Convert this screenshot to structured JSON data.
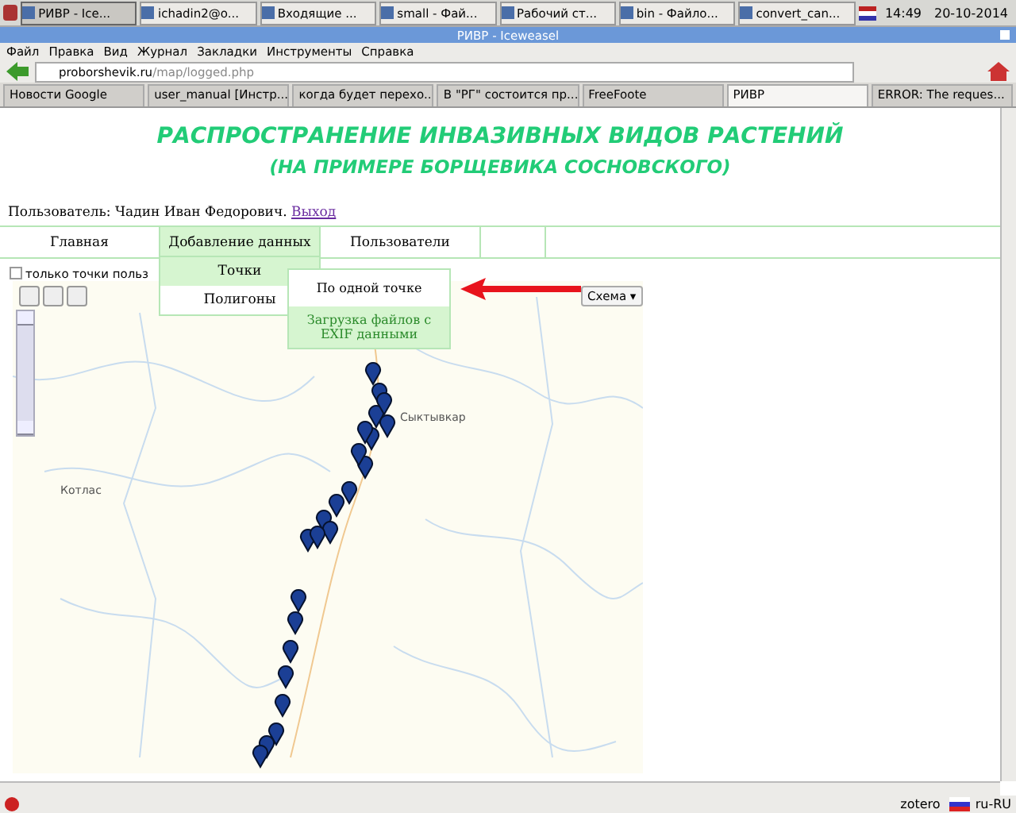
{
  "taskbar": {
    "items": [
      {
        "label": "РИВР - Ice...",
        "selected": true
      },
      {
        "label": "ichadin2@o...",
        "selected": false
      },
      {
        "label": "Входящие ...",
        "selected": false
      },
      {
        "label": "small - Фай...",
        "selected": false
      },
      {
        "label": "Рабочий ст...",
        "selected": false
      },
      {
        "label": "bin - Файло...",
        "selected": false
      },
      {
        "label": "convert_can...",
        "selected": false
      }
    ],
    "time": "14:49",
    "date": "20-10-2014"
  },
  "window": {
    "title": "РИВР - Iceweasel"
  },
  "menu": [
    "Файл",
    "Правка",
    "Вид",
    "Журнал",
    "Закладки",
    "Инструменты",
    "Справка"
  ],
  "address": {
    "host": "proborshevik.ru",
    "path": "/map/logged.php"
  },
  "tabs": [
    {
      "label": "Новости Google",
      "selected": false
    },
    {
      "label": "user_manual [Инстр...",
      "selected": false
    },
    {
      "label": "когда будет перехо...",
      "selected": false
    },
    {
      "label": "В \"РГ\" состоится пр...",
      "selected": false
    },
    {
      "label": "FreeFoote",
      "selected": false
    },
    {
      "label": "РИВР",
      "selected": true
    },
    {
      "label": "ERROR: The reques...",
      "selected": false
    }
  ],
  "page": {
    "title": "РАСПРОСТРАНЕНИЕ ИНВАЗИВНЫХ ВИДОВ РАСТЕНИЙ",
    "subtitle": "(НА ПРИМЕРЕ БОРЩЕВИКА СОСНОВСКОГО)",
    "user": "Пользователь: Чадин Иван Федорович.",
    "logout": "Выход",
    "nav": [
      {
        "label": "Главная",
        "selected": false
      },
      {
        "label": "Добавление данных",
        "selected": true
      },
      {
        "label": "Пользователи",
        "selected": false
      }
    ],
    "dropdown": [
      {
        "label": "Точки",
        "selected": true
      },
      {
        "label": "Полигоны",
        "selected": false
      }
    ],
    "submenu": [
      {
        "label": "По одной точке",
        "selected": false
      },
      {
        "label": "Загрузка файлов с EXIF данными",
        "selected": true
      }
    ],
    "filter": {
      "label": "только точки польз",
      "checked": false
    },
    "map": {
      "layer_button": "Схема ▾",
      "places": [
        "Сыктывкар",
        "Котлас"
      ]
    }
  },
  "status_bar": {
    "addon": "zotero",
    "locale": "ru-RU"
  }
}
